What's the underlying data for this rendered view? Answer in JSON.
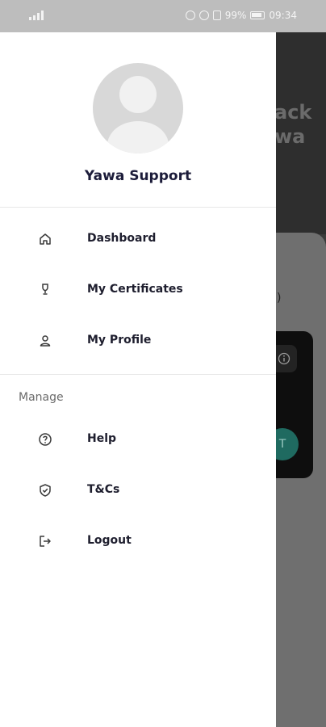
{
  "status_bar": {
    "battery": "99%",
    "time": "09:34"
  },
  "background": {
    "title_line1": "ack",
    "title_line2": "wa",
    "paren": ")",
    "info_icon": "info-icon",
    "fab_text": "T"
  },
  "drawer": {
    "user_name": "Yawa Support",
    "items": [
      {
        "label": "Dashboard",
        "icon": "home-icon"
      },
      {
        "label": "My Certificates",
        "icon": "trophy-icon"
      },
      {
        "label": "My Profile",
        "icon": "person-icon"
      }
    ],
    "section_label": "Manage",
    "manage_items": [
      {
        "label": "Help",
        "icon": "help-icon"
      },
      {
        "label": "T&Cs",
        "icon": "shield-check-icon"
      },
      {
        "label": "Logout",
        "icon": "logout-icon"
      }
    ]
  }
}
